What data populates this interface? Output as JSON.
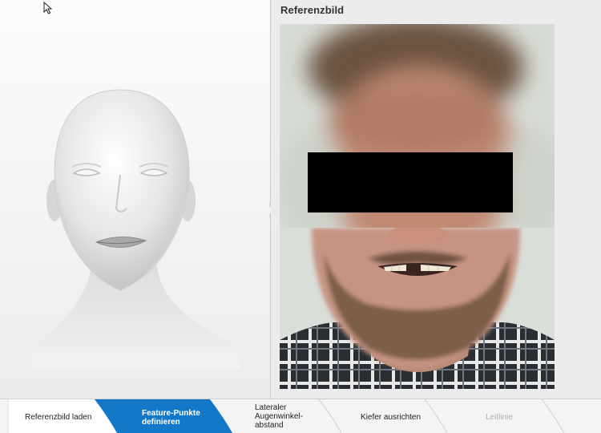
{
  "reference": {
    "title": "Referenzbild"
  },
  "steps": [
    {
      "label": "Referenzbild laden",
      "state": "done"
    },
    {
      "label": "Feature-Punkte\ndefinieren",
      "state": "active"
    },
    {
      "label": "Lateraler\nAugenwinkel-\nabstand",
      "state": "pending"
    },
    {
      "label": "Kiefer ausrichten",
      "state": "pending"
    },
    {
      "label": "Leitlinie",
      "state": "disabled"
    }
  ],
  "colors": {
    "active_step": "#1478c8",
    "disabled_text": "#b0b0b0",
    "title_text": "#333333"
  },
  "icons": {
    "cursor": "mouse-pointer-icon"
  }
}
